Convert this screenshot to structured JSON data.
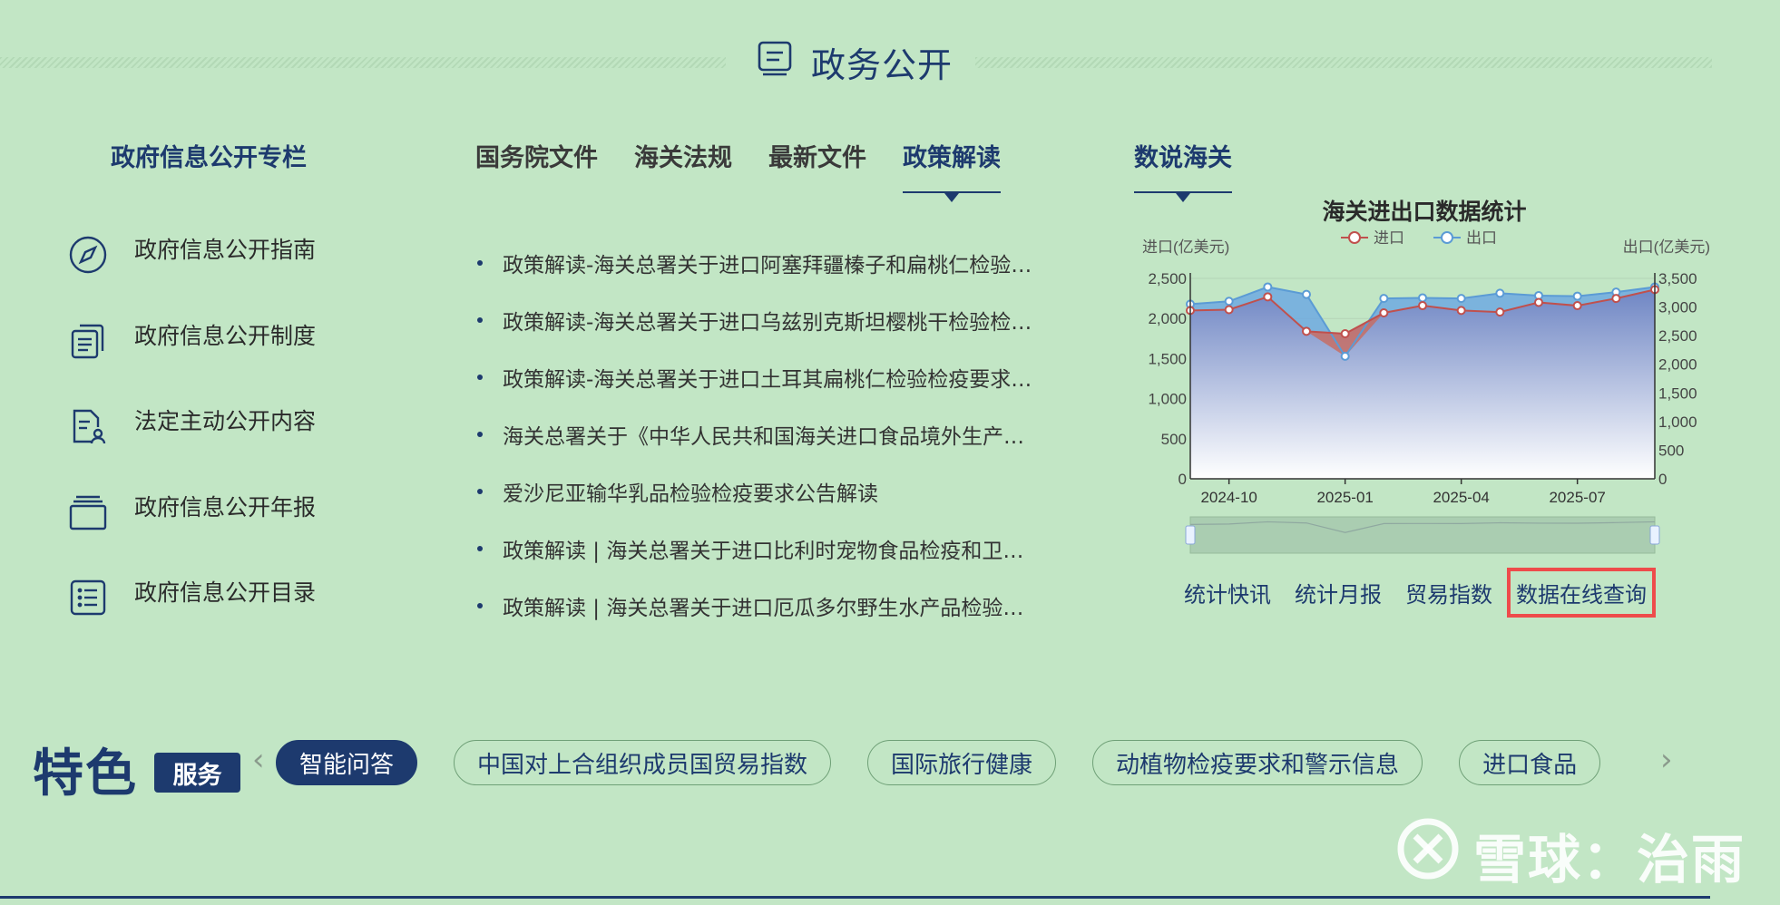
{
  "header": {
    "title": "政务公开"
  },
  "left": {
    "title": "政府信息公开专栏",
    "items": [
      {
        "icon": "compass-icon",
        "label": "政府信息公开指南"
      },
      {
        "icon": "document-stack-icon",
        "label": "政府信息公开制度"
      },
      {
        "icon": "document-person-icon",
        "label": "法定主动公开内容"
      },
      {
        "icon": "folder-icon",
        "label": "政府信息公开年报"
      },
      {
        "icon": "list-icon",
        "label": "政府信息公开目录"
      }
    ]
  },
  "middle": {
    "tabs": [
      {
        "label": "国务院文件",
        "active": false
      },
      {
        "label": "海关法规",
        "active": false
      },
      {
        "label": "最新文件",
        "active": false
      },
      {
        "label": "政策解读",
        "active": true
      }
    ],
    "news": [
      "政策解读-海关总署关于进口阿塞拜疆榛子和扁桃仁检验…",
      "政策解读-海关总署关于进口乌兹别克斯坦樱桃干检验检…",
      "政策解读-海关总署关于进口土耳其扁桃仁检验检疫要求…",
      "海关总署关于《中华人民共和国海关进口食品境外生产…",
      "爱沙尼亚输华乳品检验检疫要求公告解读",
      "政策解读 | 海关总署关于进口比利时宠物食品检疫和卫…",
      "政策解读 | 海关总署关于进口厄瓜多尔野生水产品检验…"
    ]
  },
  "right": {
    "tab": "数说海关",
    "links": [
      {
        "label": "统计快讯",
        "highlight": false
      },
      {
        "label": "统计月报",
        "highlight": false
      },
      {
        "label": "贸易指数",
        "highlight": false
      },
      {
        "label": "数据在线查询",
        "highlight": true
      }
    ]
  },
  "chart_data": {
    "type": "area",
    "title": "海关进出口数据统计",
    "ylabel_left": "进口(亿美元)",
    "ylabel_right": "出口(亿美元)",
    "x_ticks": [
      "2024-10",
      "2025-01",
      "2025-04",
      "2025-07"
    ],
    "x": [
      "2024-09",
      "2024-10",
      "2024-11",
      "2024-12",
      "2025-01",
      "2025-02",
      "2025-03",
      "2025-04",
      "2025-05",
      "2025-06",
      "2025-07",
      "2025-08",
      "2025-09"
    ],
    "ylim_left": [
      0,
      2500
    ],
    "ylim_right": [
      0,
      3500
    ],
    "y_ticks_left": [
      "0",
      "500",
      "1,000",
      "1,500",
      "2,000",
      "2,500"
    ],
    "y_ticks_right": [
      "0",
      "500",
      "1,000",
      "1,500",
      "2,000",
      "2,500",
      "3,000",
      "3,500"
    ],
    "legend_position": "top",
    "series": [
      {
        "name": "进口",
        "axis": "left",
        "color": "#c0504d",
        "values": [
          2100,
          2110,
          2270,
          1840,
          1810,
          2070,
          2160,
          2100,
          2080,
          2200,
          2160,
          2250,
          2360
        ]
      },
      {
        "name": "出口",
        "axis": "right",
        "color": "#5b9bd5",
        "values": [
          3050,
          3100,
          3350,
          3220,
          2140,
          3150,
          3160,
          3150,
          3240,
          3200,
          3190,
          3260,
          3350
        ]
      }
    ]
  },
  "features": {
    "title": "特色",
    "badge": "服务",
    "prev_arrow": "‹",
    "next_arrow": "›",
    "chips": [
      {
        "label": "智能问答",
        "active": true
      },
      {
        "label": "中国对上合组织成员国贸易指数",
        "active": false
      },
      {
        "label": "国际旅行健康",
        "active": false
      },
      {
        "label": "动植物检疫要求和警示信息",
        "active": false
      },
      {
        "label": "进口食品",
        "active": false
      }
    ]
  },
  "watermark": {
    "text": "雪球：治雨"
  },
  "colors": {
    "background": "#c2e6c5",
    "primary": "#1d3a6e",
    "highlight": "#ee4b4b"
  }
}
